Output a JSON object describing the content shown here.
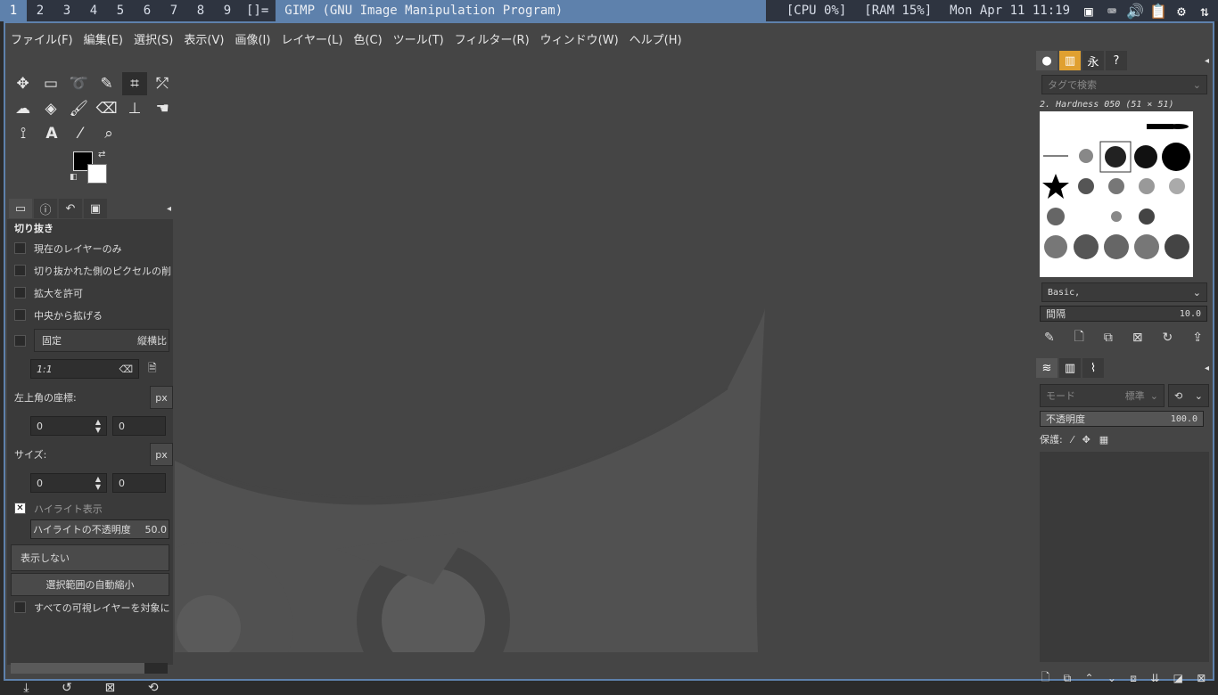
{
  "topbar": {
    "workspaces": [
      "1",
      "2",
      "3",
      "4",
      "5",
      "6",
      "7",
      "8",
      "9"
    ],
    "layout": "[]=",
    "window_title": "GIMP (GNU Image Manipulation Program)",
    "cpu": "[CPU 0%]",
    "ram": "[RAM 15%]",
    "clock": "Mon Apr 11 11:19"
  },
  "menu": [
    "ファイル(F)",
    "編集(E)",
    "選択(S)",
    "表示(V)",
    "画像(I)",
    "レイヤー(L)",
    "色(C)",
    "ツール(T)",
    "フィルター(R)",
    "ウィンドウ(W)",
    "ヘルプ(H)"
  ],
  "tool_options": {
    "title": "切り抜き",
    "current_layer_only": "現在のレイヤーのみ",
    "delete_cropped": "切り抜かれた側のピクセルの削",
    "allow_growing": "拡大を許可",
    "expand_center": "中央から拡げる",
    "fixed": "固定",
    "fixed_mode": "縦横比",
    "ratio": "1:1",
    "position_label": "左上角の座標:",
    "unit": "px",
    "pos_x": "0",
    "pos_y": "0",
    "size_label": "サイズ:",
    "size_w": "0",
    "size_h": "0",
    "highlight": "ハイライト表示",
    "highlight_opacity_label": "ハイライトの不透明度",
    "highlight_opacity_value": "50.0",
    "guides": "表示しない",
    "auto_shrink": "選択範囲の自動縮小",
    "shrink_merged": "すべての可視レイヤーを対象に"
  },
  "brushes": {
    "filter_placeholder": "タグで検索",
    "selected": "2. Hardness 050 (51 × 51)",
    "tag": "Basic,",
    "spacing_label": "間隔",
    "spacing_value": "10.0"
  },
  "layers": {
    "mode_placeholder": "モード",
    "mode_value": "標準",
    "opacity_label": "不透明度",
    "opacity_value": "100.0",
    "lock_label": "保護:"
  }
}
